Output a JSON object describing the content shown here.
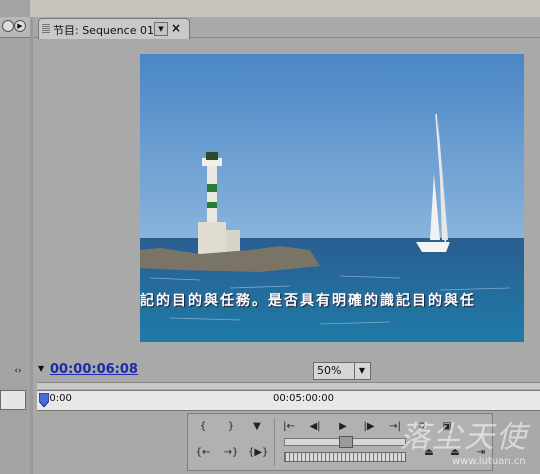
{
  "tab": {
    "title": "节目: Sequence 01",
    "menu_icon": "triangle-down-icon",
    "close_label": "×"
  },
  "timecode": {
    "current": "00:00:06:08"
  },
  "zoom": {
    "value": "50%",
    "options": [
      "50%"
    ]
  },
  "ruler": {
    "ticks": [
      "00:00",
      "00:05:00:00"
    ]
  },
  "video": {
    "subtitle": "記的目的與任務。是否具有明確的識記目的與任"
  },
  "playhead": {
    "fraction": 0.0
  },
  "jog": {
    "fraction": 0.5
  },
  "watermark": {
    "text": "落尘天使",
    "url": "www.lutuan.cn"
  },
  "colors": {
    "timecode": "#1a2aa8",
    "sky": "#5a92cc",
    "sea": "#1e6aa0"
  }
}
